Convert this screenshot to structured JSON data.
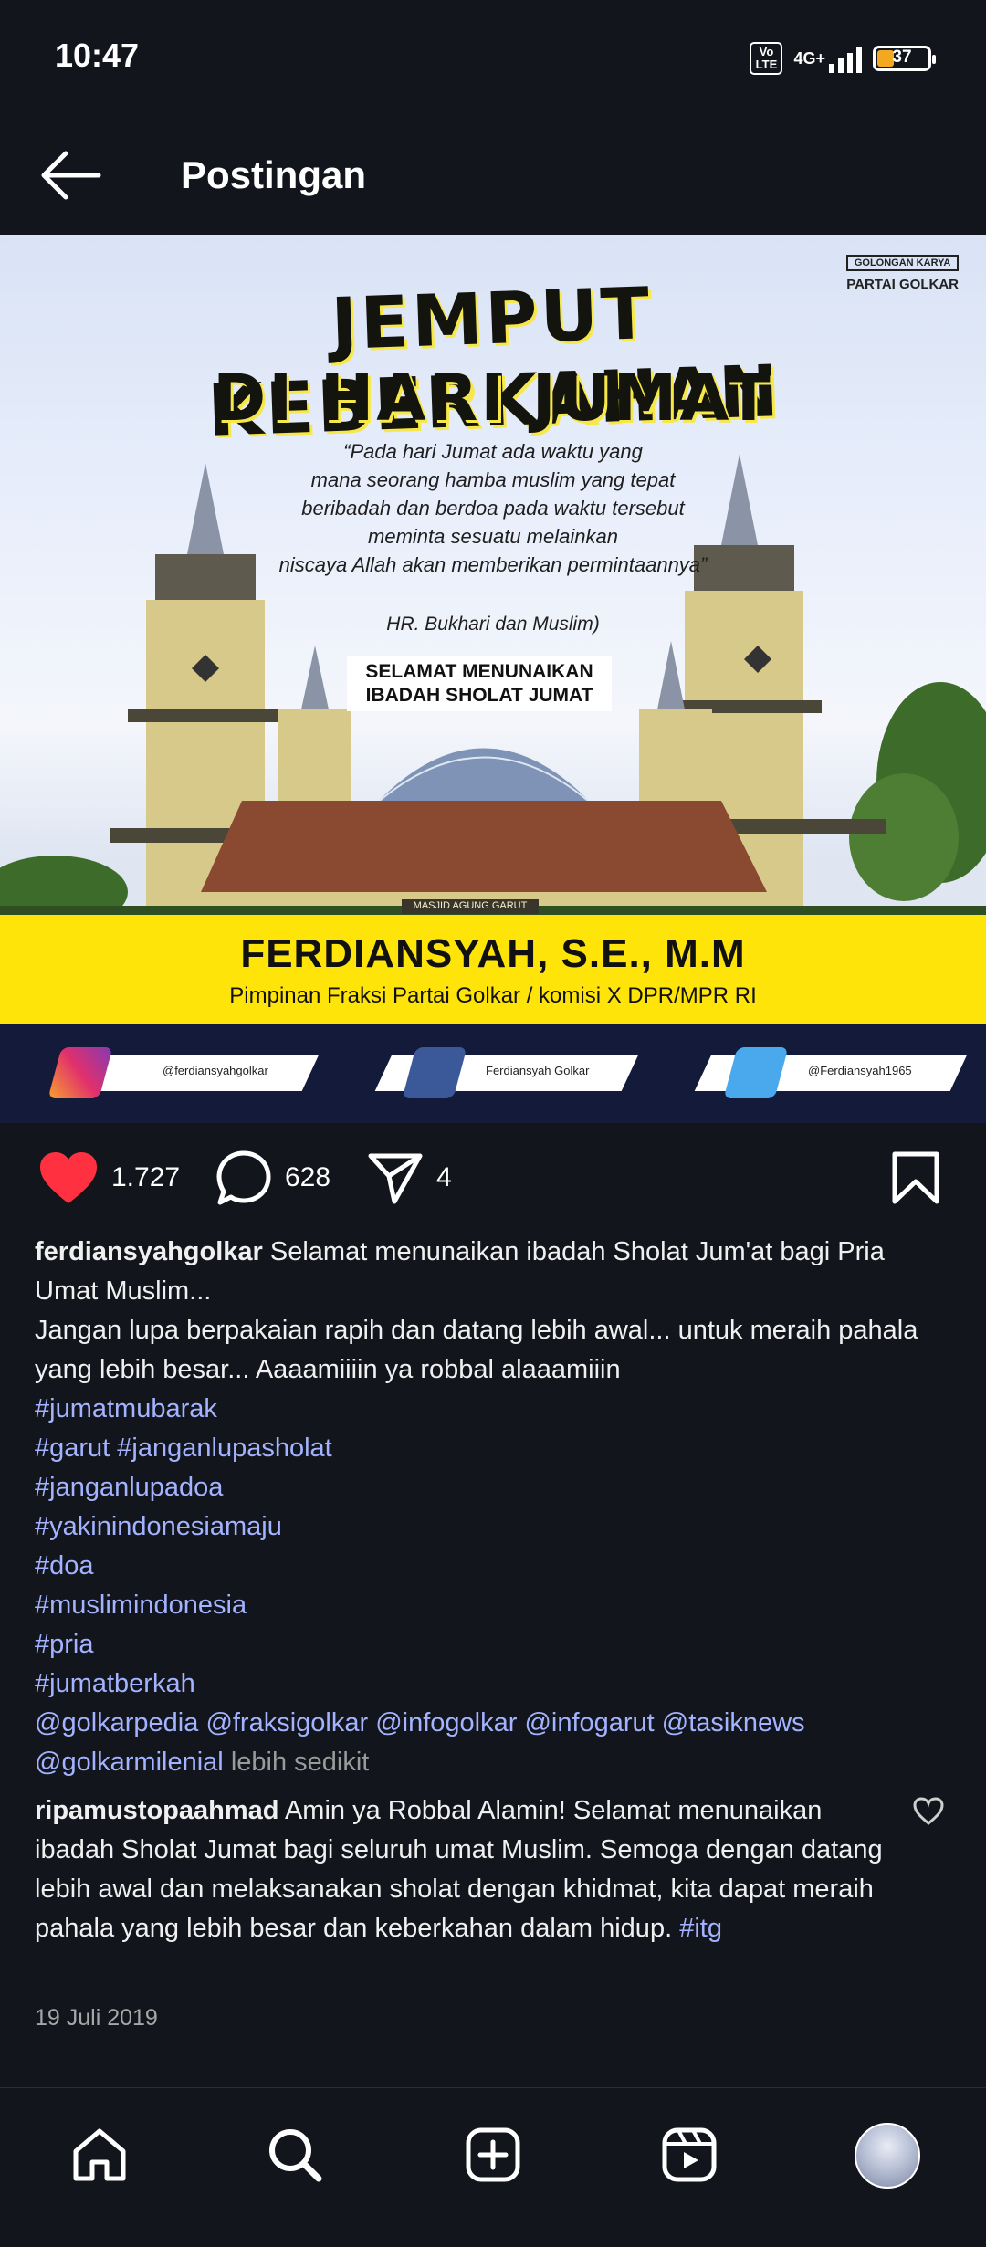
{
  "status_bar": {
    "time": "10:47",
    "volte": "Vo LTE",
    "network": "4G+",
    "battery": "37",
    "battery_level_percent": 37
  },
  "header": {
    "title": "Postingan"
  },
  "post_image": {
    "logo_small": "GOLONGAN KARYA",
    "logo_big": "PARTAI GOLKAR",
    "title_line1": "JEMPUT KEBERKAHAN",
    "title_line2": "DI HARI JUMAT",
    "quote_lines": [
      "“Pada hari Jumat ada waktu yang",
      "mana seorang hamba muslim yang tepat",
      "beribadah dan berdoa pada waktu tersebut",
      "meminta sesuatu melainkan",
      "niscaya Allah akan memberikan permintaannya”"
    ],
    "source": "HR. Bukhari dan Muslim)",
    "greeting_line1": "SELAMAT MENUNAIKAN",
    "greeting_line2": "IBADAH SHOLAT JUMAT",
    "mosque_sign": "MASJID AGUNG GARUT",
    "name": "FERDIANSYAH, S.E., M.M",
    "role": "Pimpinan Fraksi Partai Golkar / komisi X DPR/MPR RI",
    "socials": {
      "instagram": "@ferdiansyahgolkar",
      "facebook": "Ferdiansyah Golkar",
      "twitter": "@Ferdiansyah1965"
    }
  },
  "actions": {
    "likes": "1.727",
    "comments": "628",
    "shares": "4"
  },
  "caption": {
    "username": "ferdiansyahgolkar",
    "text1": "Selamat menunaikan ibadah Sholat Jum'at bagi Pria Umat Muslim...",
    "text2": "Jangan lupa berpakaian rapih dan datang lebih awal... untuk meraih pahala yang lebih besar... Aaaamiiiin ya robbal alaaamiiin",
    "hashtags": [
      "#jumatmubarak",
      "#garut #janganlupasholat",
      "#janganlupadoa",
      "#yakinindonesiamaju",
      "#doa",
      "#muslimindonesia",
      "#pria",
      "#jumatberkah"
    ],
    "mentions": "@golkarpedia @fraksigolkar @infogolkar @infogarut @tasiknews @golkarmilenial",
    "more": "lebih sedikit"
  },
  "comment": {
    "username": "ripamustopaahmad",
    "text": "Amin ya Robbal Alamin! Selamat menunaikan ibadah Sholat Jumat bagi seluruh umat Muslim. Semoga dengan datang lebih awal dan melaksanakan sholat dengan khidmat, kita dapat meraih pahala yang lebih besar dan keberkahan dalam hidup.",
    "tag": "#itg"
  },
  "post_date": "19 Juli 2019",
  "colors": {
    "background": "#12151c",
    "link": "#a3b3ff",
    "like": "#ff3040",
    "banner_yellow": "#ffe40a"
  },
  "bottom_nav": [
    "home-icon",
    "search-icon",
    "create-icon",
    "reels-icon",
    "profile-avatar"
  ]
}
